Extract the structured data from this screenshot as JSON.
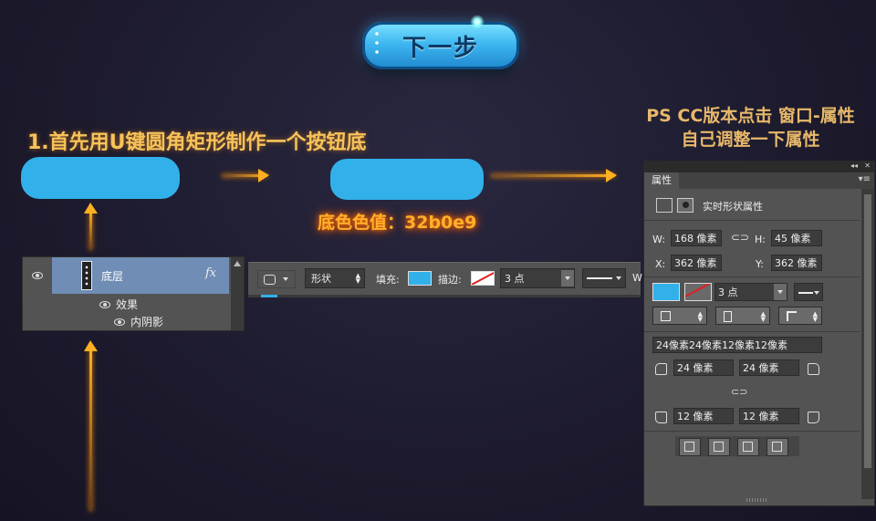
{
  "hero_button": {
    "label": "下一步"
  },
  "step_title": "1.首先用U键圆角矩形制作一个按钮底",
  "right_note": {
    "line1": "PS CC版本点击 窗口-属性",
    "line2": "自己调整一下属性"
  },
  "color_value_label": "底色色值：32b0e9",
  "colors": {
    "button_fill": "#32b0e9",
    "arrow": "#ffb020"
  },
  "layers_panel": {
    "layer_name": "底层",
    "fx_label": "fx",
    "effects_label": "效果",
    "inner_shadow_label": "内阴影"
  },
  "options_bar": {
    "mode_value": "形状",
    "fill_label": "填充:",
    "stroke_label": "描边:",
    "stroke_width": "3 点",
    "trailing": "W"
  },
  "properties_panel": {
    "tab_label": "属性",
    "header_label": "实时形状属性",
    "w_label": "W:",
    "w_value": "168 像素",
    "h_label": "H:",
    "h_value": "45 像素",
    "x_label": "X:",
    "x_value": "362 像素",
    "y_label": "Y:",
    "y_value": "362 像素",
    "stroke_width": "3 点",
    "radii_summary": "24像素24像素12像素12像素",
    "radius_tl": "24 像素",
    "radius_tr": "24 像素",
    "radius_bl": "12 像素",
    "radius_br": "12 像素"
  }
}
